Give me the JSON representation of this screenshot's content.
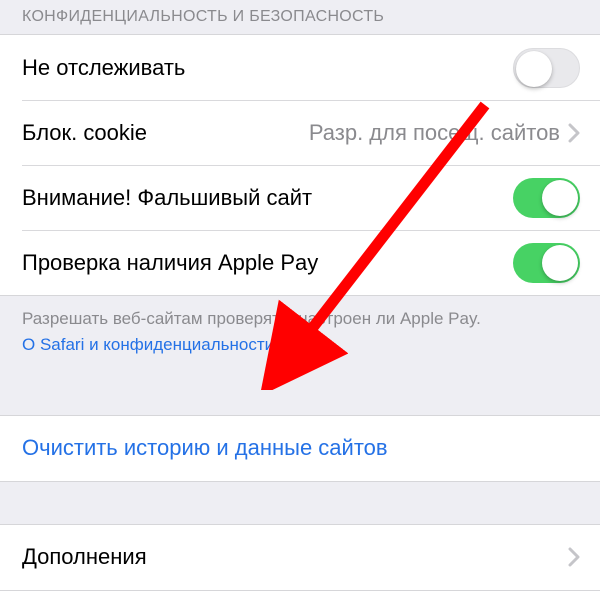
{
  "section_header": "КОНФИДЕНЦИАЛЬНОСТЬ И БЕЗОПАСНОСТЬ",
  "rows": {
    "do_not_track": {
      "label": "Не отслеживать",
      "on": false
    },
    "block_cookies": {
      "label": "Блок. cookie",
      "value": "Разр. для посещ. сайтов"
    },
    "fraud_warning": {
      "label": "Внимание! Фальшивый сайт",
      "on": true
    },
    "apple_pay_check": {
      "label": "Проверка наличия Apple Pay",
      "on": true
    }
  },
  "footer": {
    "text": "Разрешать веб-сайтам проверять, настроен ли Apple Pay.",
    "link": "О Safari и конфиденциальности…"
  },
  "clear_action": "Очистить историю и данные сайтов",
  "extensions": {
    "label": "Дополнения"
  },
  "colors": {
    "link": "#2471e6",
    "switch_on": "#47d264",
    "arrow": "#ff0000"
  }
}
